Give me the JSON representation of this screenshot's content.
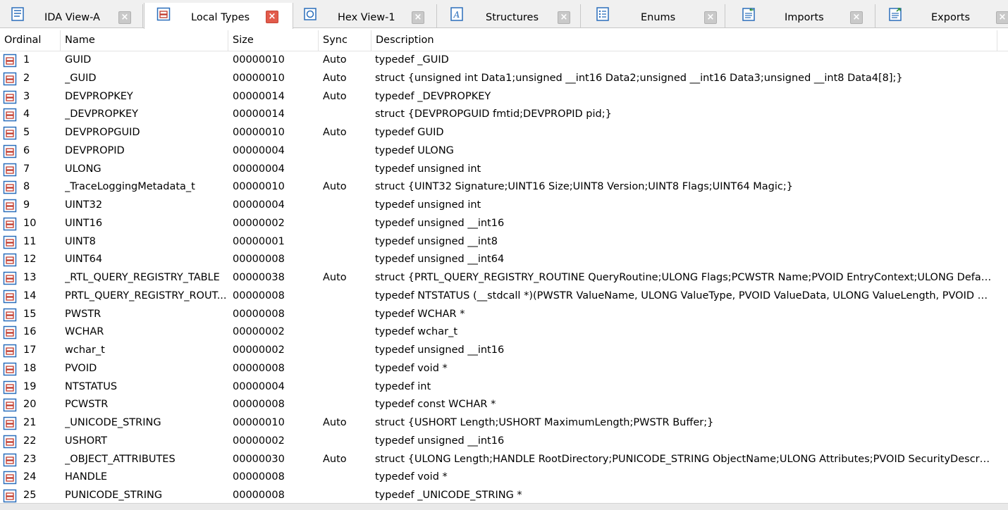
{
  "tabs": [
    {
      "label": "IDA View-A",
      "icon": "ida-view-icon",
      "active": false
    },
    {
      "label": "Local Types",
      "icon": "local-types-icon",
      "active": true
    },
    {
      "label": "Hex View-1",
      "icon": "hex-view-icon",
      "active": false
    },
    {
      "label": "Structures",
      "icon": "structures-icon",
      "active": false
    },
    {
      "label": "Enums",
      "icon": "enums-icon",
      "active": false
    },
    {
      "label": "Imports",
      "icon": "imports-icon",
      "active": false
    },
    {
      "label": "Exports",
      "icon": "exports-icon",
      "active": false
    }
  ],
  "columns": {
    "ordinal": "Ordinal",
    "name": "Name",
    "size": "Size",
    "sync": "Sync",
    "description": "Description"
  },
  "row_icon": "local-type-icon",
  "rows": [
    {
      "ordinal": "1",
      "name": "GUID",
      "size": "00000010",
      "sync": "Auto",
      "description": "typedef _GUID"
    },
    {
      "ordinal": "2",
      "name": "_GUID",
      "size": "00000010",
      "sync": "Auto",
      "description": "struct {unsigned int Data1;unsigned __int16 Data2;unsigned __int16 Data3;unsigned __int8 Data4[8];}"
    },
    {
      "ordinal": "3",
      "name": "DEVPROPKEY",
      "size": "00000014",
      "sync": "Auto",
      "description": "typedef _DEVPROPKEY"
    },
    {
      "ordinal": "4",
      "name": "_DEVPROPKEY",
      "size": "00000014",
      "sync": "",
      "description": "struct {DEVPROPGUID fmtid;DEVPROPID pid;}"
    },
    {
      "ordinal": "5",
      "name": "DEVPROPGUID",
      "size": "00000010",
      "sync": "Auto",
      "description": "typedef GUID"
    },
    {
      "ordinal": "6",
      "name": "DEVPROPID",
      "size": "00000004",
      "sync": "",
      "description": "typedef ULONG"
    },
    {
      "ordinal": "7",
      "name": "ULONG",
      "size": "00000004",
      "sync": "",
      "description": "typedef unsigned int"
    },
    {
      "ordinal": "8",
      "name": "_TraceLoggingMetadata_t",
      "size": "00000010",
      "sync": "Auto",
      "description": "struct {UINT32 Signature;UINT16 Size;UINT8 Version;UINT8 Flags;UINT64 Magic;}"
    },
    {
      "ordinal": "9",
      "name": "UINT32",
      "size": "00000004",
      "sync": "",
      "description": "typedef unsigned int"
    },
    {
      "ordinal": "10",
      "name": "UINT16",
      "size": "00000002",
      "sync": "",
      "description": "typedef unsigned __int16"
    },
    {
      "ordinal": "11",
      "name": "UINT8",
      "size": "00000001",
      "sync": "",
      "description": "typedef unsigned __int8"
    },
    {
      "ordinal": "12",
      "name": "UINT64",
      "size": "00000008",
      "sync": "",
      "description": "typedef unsigned __int64"
    },
    {
      "ordinal": "13",
      "name": "_RTL_QUERY_REGISTRY_TABLE",
      "size": "00000038",
      "sync": "Auto",
      "description": "struct {PRTL_QUERY_REGISTRY_ROUTINE QueryRoutine;ULONG Flags;PCWSTR Name;PVOID EntryContext;ULONG Default..."
    },
    {
      "ordinal": "14",
      "name": "PRTL_QUERY_REGISTRY_ROUT...",
      "size": "00000008",
      "sync": "",
      "description": "typedef NTSTATUS (__stdcall *)(PWSTR ValueName, ULONG ValueType, PVOID ValueData, ULONG ValueLength, PVOID Con..."
    },
    {
      "ordinal": "15",
      "name": "PWSTR",
      "size": "00000008",
      "sync": "",
      "description": "typedef WCHAR *"
    },
    {
      "ordinal": "16",
      "name": "WCHAR",
      "size": "00000002",
      "sync": "",
      "description": "typedef wchar_t"
    },
    {
      "ordinal": "17",
      "name": "wchar_t",
      "size": "00000002",
      "sync": "",
      "description": "typedef unsigned __int16"
    },
    {
      "ordinal": "18",
      "name": "PVOID",
      "size": "00000008",
      "sync": "",
      "description": "typedef void *"
    },
    {
      "ordinal": "19",
      "name": "NTSTATUS",
      "size": "00000004",
      "sync": "",
      "description": "typedef int"
    },
    {
      "ordinal": "20",
      "name": "PCWSTR",
      "size": "00000008",
      "sync": "",
      "description": "typedef const WCHAR *"
    },
    {
      "ordinal": "21",
      "name": "_UNICODE_STRING",
      "size": "00000010",
      "sync": "Auto",
      "description": "struct {USHORT Length;USHORT MaximumLength;PWSTR Buffer;}"
    },
    {
      "ordinal": "22",
      "name": "USHORT",
      "size": "00000002",
      "sync": "",
      "description": "typedef unsigned __int16"
    },
    {
      "ordinal": "23",
      "name": "_OBJECT_ATTRIBUTES",
      "size": "00000030",
      "sync": "Auto",
      "description": "struct {ULONG Length;HANDLE RootDirectory;PUNICODE_STRING ObjectName;ULONG Attributes;PVOID SecurityDescrip..."
    },
    {
      "ordinal": "24",
      "name": "HANDLE",
      "size": "00000008",
      "sync": "",
      "description": "typedef void *"
    },
    {
      "ordinal": "25",
      "name": "PUNICODE_STRING",
      "size": "00000008",
      "sync": "",
      "description": "typedef _UNICODE_STRING *"
    }
  ]
}
